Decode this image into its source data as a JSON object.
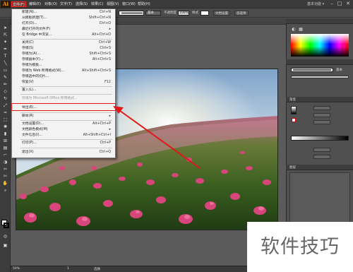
{
  "app": {
    "logo": "Ai"
  },
  "menubar": {
    "items": [
      "文件(F)",
      "编辑(E)",
      "对象(O)",
      "文字(T)",
      "选择(S)",
      "效果(C)",
      "视图(V)",
      "窗口(W)",
      "帮助(H)"
    ],
    "workspace": "基本功能 ▾",
    "minimize": "–",
    "maximize": "□",
    "close": "✕"
  },
  "control_bar": {
    "mode": "基本",
    "opacity_label": "不透明度",
    "opacity_value": "100%",
    "style_label": "样式",
    "doc_setup": "文档设置",
    "prefs": "首选项"
  },
  "file_menu": [
    {
      "label": "新建(N)...",
      "shortcut": "Ctrl+N",
      "enabled": true
    },
    {
      "label": "从模板新建(T)...",
      "shortcut": "Shift+Ctrl+N",
      "enabled": true
    },
    {
      "label": "打开(O)...",
      "shortcut": "Ctrl+O",
      "enabled": true
    },
    {
      "label": "最近打开的文件(F)",
      "shortcut": "▸",
      "enabled": true
    },
    {
      "label": "在 Bridge 中浏览...",
      "shortcut": "Alt+Ctrl+O",
      "enabled": true
    },
    {
      "label": "关闭(C)",
      "shortcut": "Ctrl+W",
      "enabled": true
    },
    {
      "label": "存储(S)",
      "shortcut": "Ctrl+S",
      "enabled": true
    },
    {
      "label": "存储为(A)...",
      "shortcut": "Shift+Ctrl+S",
      "enabled": true
    },
    {
      "label": "存储副本(Y)...",
      "shortcut": "Alt+Ctrl+S",
      "enabled": true
    },
    {
      "label": "存储为模板...",
      "shortcut": "",
      "enabled": true
    },
    {
      "label": "存储为 Web 所用格式(W)...",
      "shortcut": "Alt+Shift+Ctrl+S",
      "enabled": true
    },
    {
      "label": "存储选中的切片...",
      "shortcut": "",
      "enabled": true
    },
    {
      "label": "恢复(V)",
      "shortcut": "F12",
      "enabled": true
    },
    {
      "label": "置入(L)...",
      "shortcut": "",
      "enabled": true
    },
    {
      "label": "存储为 Microsoft Office 所用格式...",
      "shortcut": "",
      "enabled": false
    },
    {
      "label": "导出(E)...",
      "shortcut": "",
      "enabled": true
    },
    {
      "label": "脚本(R)",
      "shortcut": "▸",
      "enabled": true
    },
    {
      "label": "文档设置(D)...",
      "shortcut": "Alt+Ctrl+P",
      "enabled": true
    },
    {
      "label": "文档颜色模式(M)",
      "shortcut": "▸",
      "enabled": true
    },
    {
      "label": "文件信息(I)...",
      "shortcut": "Alt+Shift+Ctrl+I",
      "enabled": true
    },
    {
      "label": "打印(P)...",
      "shortcut": "Ctrl+P",
      "enabled": true
    },
    {
      "label": "退出(X)",
      "shortcut": "Ctrl+Q",
      "enabled": true
    }
  ],
  "right_panels": {
    "stroke_value": "基本",
    "gradient_tab": "渐变",
    "layers_tab": "图层"
  },
  "status_bar": {
    "zoom": "50%",
    "page": "1",
    "tool": "选择"
  },
  "watermark": "软件技巧",
  "colors": {
    "highlight": "#e01818",
    "brand": "#f7941e"
  }
}
